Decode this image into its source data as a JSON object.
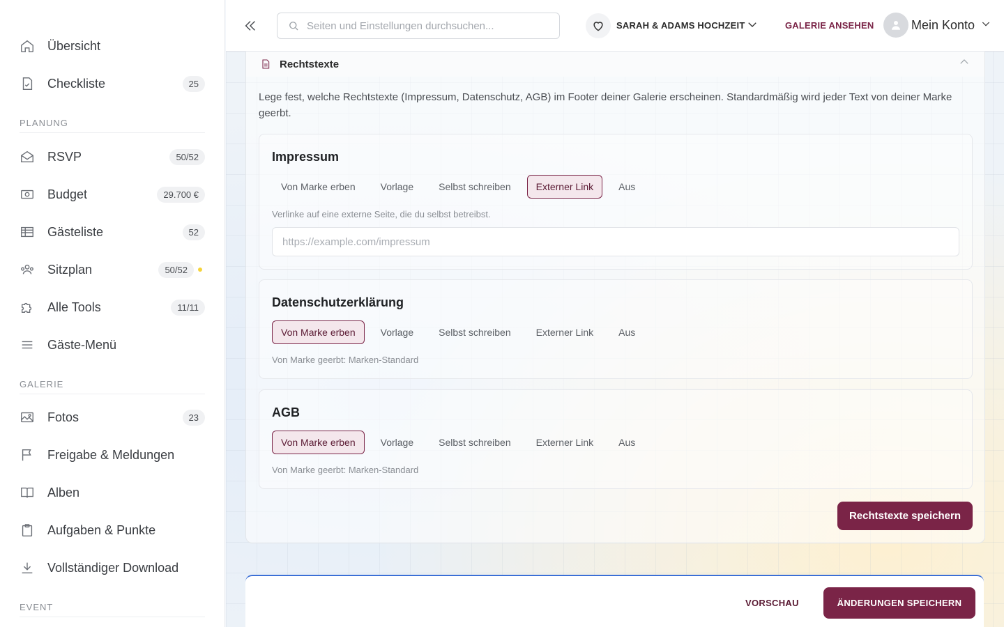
{
  "sidebar": {
    "items": [
      {
        "label": "Übersicht",
        "icon": "home-icon"
      },
      {
        "label": "Checkliste",
        "badge": "25",
        "icon": "checklist-icon"
      },
      {
        "label": "RSVP",
        "badge": "50/52",
        "icon": "envelope-icon"
      },
      {
        "label": "Budget",
        "badge": "29.700 €",
        "icon": "money-icon"
      },
      {
        "label": "Gästeliste",
        "badge": "52",
        "icon": "table-icon"
      },
      {
        "label": "Sitzplan",
        "badge": "50/52",
        "icon": "people-icon",
        "dot_color": "#f5d33a"
      },
      {
        "label": "Alle Tools",
        "badge": "11/11",
        "icon": "puzzle-icon"
      },
      {
        "label": "Gäste-Menü",
        "icon": "menu-icon"
      },
      {
        "label": "Fotos",
        "badge": "23",
        "icon": "image-icon"
      },
      {
        "label": "Freigabe & Meldungen",
        "icon": "flag-icon"
      },
      {
        "label": "Alben",
        "icon": "book-icon"
      },
      {
        "label": "Aufgaben & Punkte",
        "icon": "clipboard-icon"
      },
      {
        "label": "Vollständiger Download",
        "icon": "download-icon"
      }
    ],
    "sections": {
      "planung": "PLANUNG",
      "galerie": "GALERIE",
      "event": "EVENT"
    }
  },
  "topbar": {
    "search_placeholder": "Seiten und Einstellungen durchsuchen...",
    "event_name": "SARAH & ADAMS HOCHZEIT",
    "view_gallery": "GALERIE ANSEHEN",
    "account_label": "Mein Konto"
  },
  "card": {
    "title": "Rechtstexte",
    "intro": "Lege fest, welche Rechtstexte (Impressum, Datenschutz, AGB) im Footer deiner Galerie erscheinen. Standardmäßig wird jeder Text von deiner Marke geerbt.",
    "options": [
      "Von Marke erben",
      "Vorlage",
      "Selbst schreiben",
      "Externer Link",
      "Aus"
    ],
    "sections": [
      {
        "title": "Impressum",
        "selected": "Externer Link",
        "hint": "Verlinke auf eine externe Seite, die du selbst betreibst.",
        "url_placeholder": "https://example.com/impressum"
      },
      {
        "title": "Datenschutzerklärung",
        "selected": "Von Marke erben",
        "hint": "Von Marke geerbt: Marken-Standard"
      },
      {
        "title": "AGB",
        "selected": "Von Marke erben",
        "hint": "Von Marke geerbt: Marken-Standard"
      }
    ],
    "save_label": "Rechtstexte speichern"
  },
  "bottombar": {
    "preview_label": "VORSCHAU",
    "save_all_label": "ÄNDERUNGEN SPEICHERN"
  },
  "colors": {
    "accent": "#7a2447",
    "accent_bg": "#f4e7ec",
    "focus_blue": "#3b6fd6"
  }
}
